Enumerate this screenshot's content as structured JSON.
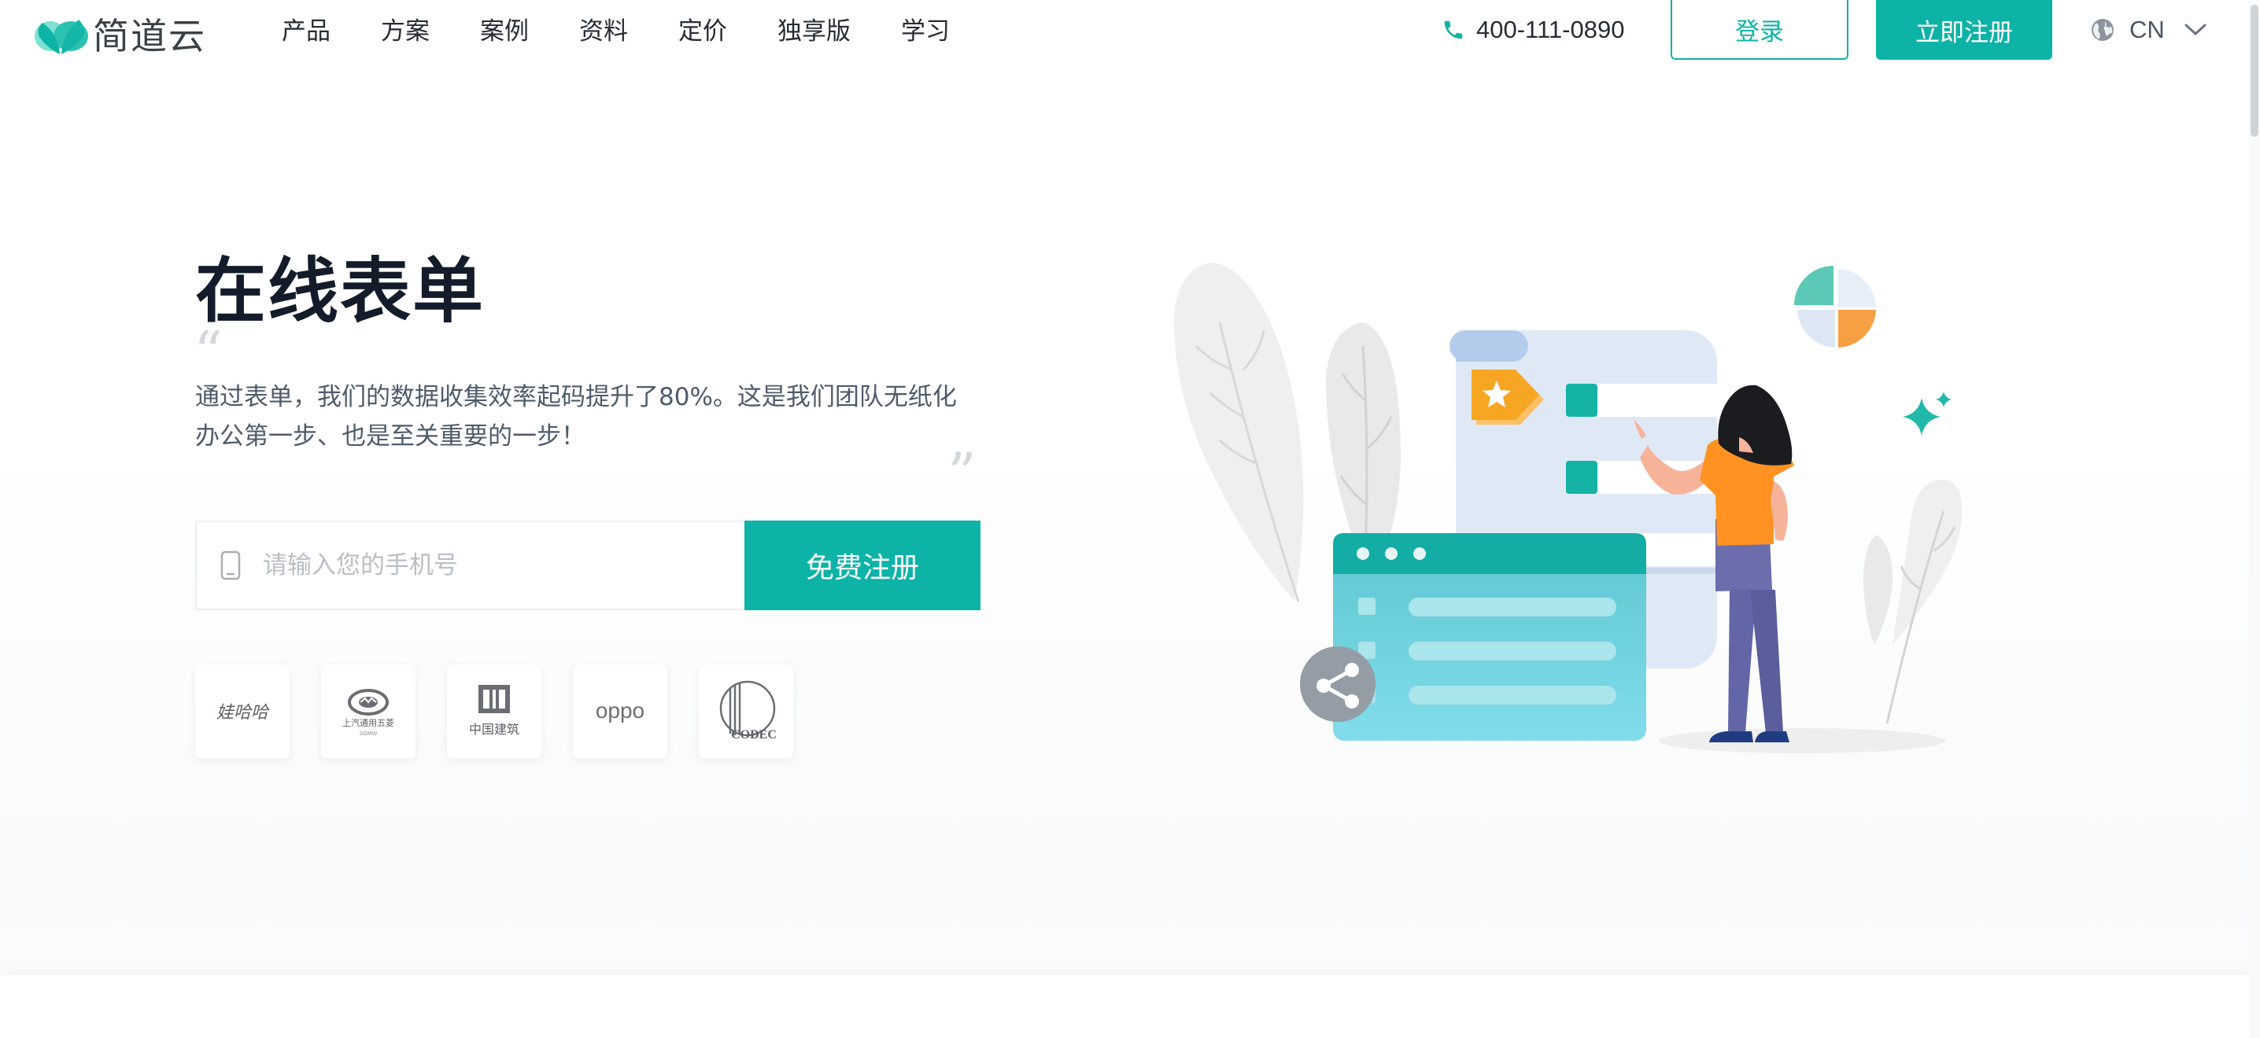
{
  "brand": {
    "name": "简道云",
    "accent": "#0db3a6"
  },
  "nav": {
    "items": [
      "产品",
      "方案",
      "案例",
      "资料",
      "定价",
      "独享版",
      "学习"
    ]
  },
  "header": {
    "phone": "400-111-0890",
    "login_label": "登录",
    "register_label": "立即注册",
    "lang_label": "CN"
  },
  "hero": {
    "title": "在线表单",
    "quote_open": "“",
    "quote_close": "”",
    "quote_line1": "通过表单，我们的数据收集效率起码提升了80%。这是我们团队无纸化",
    "quote_line2": "办公第一步、也是至关重要的一步！",
    "phone_placeholder": "请输入您的手机号",
    "signup_label": "免费注册"
  },
  "clients": {
    "wahaha": "娃哈哈",
    "saic_line1": "上汽通用五菱",
    "saic_line2": "SGMW",
    "cscec": "中国建筑",
    "oppo": "oppo",
    "codec": "CODEC"
  }
}
